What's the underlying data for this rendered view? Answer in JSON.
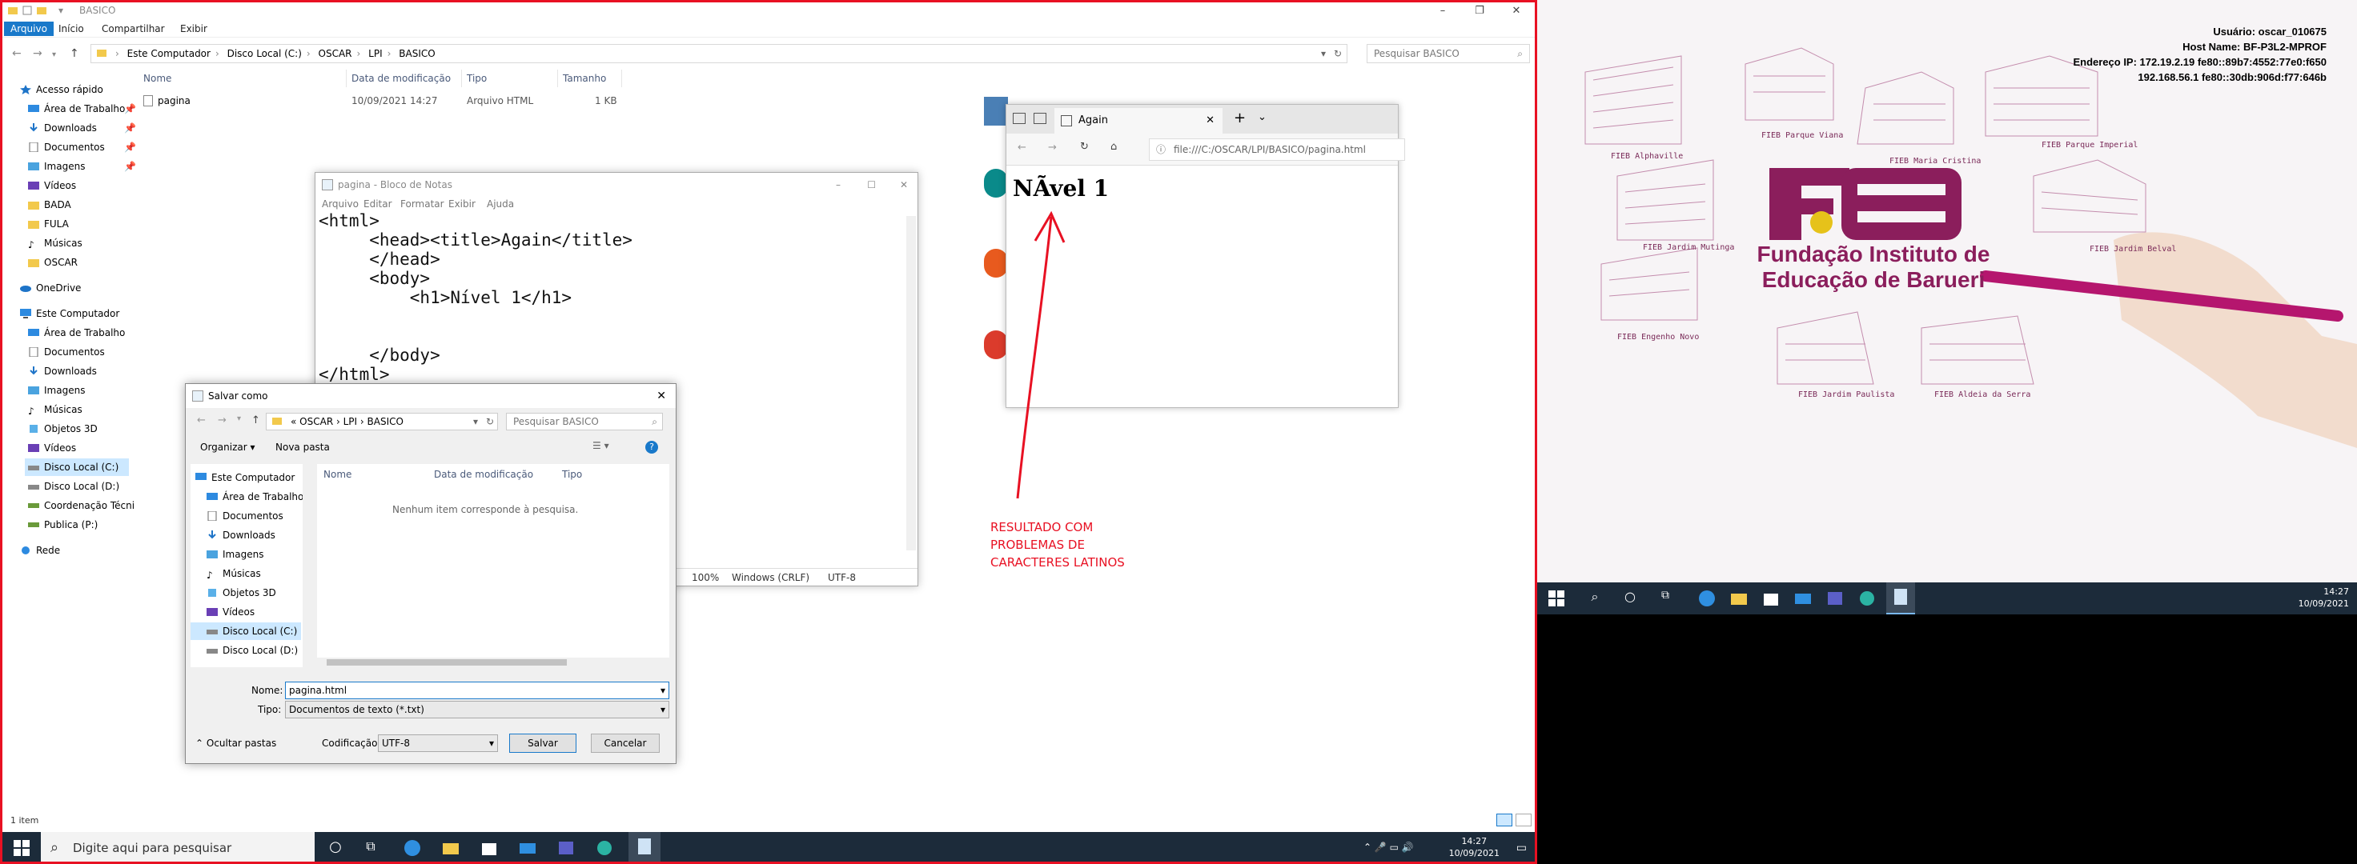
{
  "explorer": {
    "window_title": "BASICO",
    "ribbon_tabs": [
      "Arquivo",
      "Início",
      "Compartilhar",
      "Exibir"
    ],
    "breadcrumb": [
      "Este Computador",
      "Disco Local (C:)",
      "OSCAR",
      "LPI",
      "BASICO"
    ],
    "search_placeholder": "Pesquisar BASICO",
    "nav": [
      {
        "label": "Acesso rápido",
        "icon": "star-icon"
      },
      {
        "label": "Área de Trabalho",
        "icon": "desktop-icon"
      },
      {
        "label": "Downloads",
        "icon": "download-icon"
      },
      {
        "label": "Documentos",
        "icon": "document-icon"
      },
      {
        "label": "Imagens",
        "icon": "image-icon"
      },
      {
        "label": "Vídeos",
        "icon": "video-icon"
      },
      {
        "label": "BADA",
        "icon": "folder-icon"
      },
      {
        "label": "FULA",
        "icon": "folder-icon"
      },
      {
        "label": "Músicas",
        "icon": "music-icon"
      },
      {
        "label": "OSCAR",
        "icon": "folder-icon"
      },
      {
        "label": "OneDrive",
        "icon": "cloud-icon"
      },
      {
        "label": "Este Computador",
        "icon": "computer-icon"
      },
      {
        "label": "Área de Trabalho",
        "icon": "desktop-icon"
      },
      {
        "label": "Documentos",
        "icon": "document-icon"
      },
      {
        "label": "Downloads",
        "icon": "download-icon"
      },
      {
        "label": "Imagens",
        "icon": "image-icon"
      },
      {
        "label": "Músicas",
        "icon": "music-icon"
      },
      {
        "label": "Objetos 3D",
        "icon": "cube-icon"
      },
      {
        "label": "Vídeos",
        "icon": "video-icon"
      },
      {
        "label": "Disco Local (C:)",
        "icon": "drive-icon"
      },
      {
        "label": "Disco Local (D:)",
        "icon": "drive-icon"
      },
      {
        "label": "Coordenação Técni",
        "icon": "network-drive-icon"
      },
      {
        "label": "Publica (P:)",
        "icon": "network-drive-icon"
      },
      {
        "label": "Rede",
        "icon": "network-icon"
      }
    ],
    "columns": [
      "Nome",
      "Data de modificação",
      "Tipo",
      "Tamanho"
    ],
    "files": [
      {
        "name": "pagina",
        "modified": "10/09/2021 14:27",
        "type": "Arquivo HTML",
        "size": "1 KB"
      }
    ],
    "status": "1 item"
  },
  "notepad": {
    "title": "pagina - Bloco de Notas",
    "menu": [
      "Arquivo",
      "Editar",
      "Formatar",
      "Exibir",
      "Ajuda"
    ],
    "content": "<html>\n     <head><title>Again</title>\n     </head>\n     <body>\n         <h1>Nível 1</h1>\n\n\n     </body>\n</html>",
    "status": {
      "zoom": "100%",
      "eol": "Windows (CRLF)",
      "encoding": "UTF-8"
    }
  },
  "save_dialog": {
    "title": "Salvar como",
    "breadcrumb": [
      "«",
      "OSCAR",
      "LPI",
      "BASICO"
    ],
    "search_placeholder": "Pesquisar BASICO",
    "organize": "Organizar ▾",
    "new_folder": "Nova pasta",
    "tree": [
      {
        "label": "Este Computador",
        "icon": "computer-icon"
      },
      {
        "label": "Área de Trabalho",
        "icon": "desktop-icon"
      },
      {
        "label": "Documentos",
        "icon": "document-icon"
      },
      {
        "label": "Downloads",
        "icon": "download-icon"
      },
      {
        "label": "Imagens",
        "icon": "image-icon"
      },
      {
        "label": "Músicas",
        "icon": "music-icon"
      },
      {
        "label": "Objetos 3D",
        "icon": "cube-icon"
      },
      {
        "label": "Vídeos",
        "icon": "video-icon"
      },
      {
        "label": "Disco Local (C:)",
        "icon": "drive-icon"
      },
      {
        "label": "Disco Local (D:)",
        "icon": "drive-icon"
      }
    ],
    "columns": [
      "Nome",
      "Data de modificação",
      "Tipo"
    ],
    "empty_msg": "Nenhum item corresponde à pesquisa.",
    "name_label": "Nome:",
    "name_value": "pagina.html",
    "type_label": "Tipo:",
    "type_value": "Documentos de texto (*.txt)",
    "encoding_label": "Codificação:",
    "encoding_value": "UTF-8",
    "hide_folders": "Ocultar pastas",
    "save": "Salvar",
    "cancel": "Cancelar"
  },
  "browser": {
    "tab_title": "Again",
    "url": "file:///C:/OSCAR/LPI/BASICO/pagina.html",
    "heading": "NÃvel 1"
  },
  "annotation": {
    "lines": [
      "RESULTADO COM",
      "PROBLEMAS DE",
      "CARACTERES LATINOS"
    ],
    "color": "#e81123"
  },
  "taskbar_left": {
    "search_placeholder": "Digite aqui para pesquisar",
    "time": "14:27",
    "date": "10/09/2021"
  },
  "right_screen": {
    "bginfo": [
      "Usuário: oscar_010675",
      "Host Name: BF-P3L2-MPROF",
      "Endereço IP: 172.19.2.19 fe80::89b7:4552:77e0:f650",
      "192.168.56.1 fe80::30db:906d:f77:646b"
    ],
    "building_labels": [
      "FIEB Alphaville",
      "FIEB Parque Viana",
      "FIEB Maria Cristina",
      "FIEB Parque Imperial",
      "FIEB Jardim Mutinga",
      "FIEB Jardim Belval",
      "FIEB Engenho Novo",
      "FIEB Jardim Paulista",
      "FIEB Aldeia da Serra"
    ],
    "brand_name_lines": [
      "Fundação Instituto de",
      "Educação de Barueri"
    ],
    "brand_color": "#8b1e5c",
    "time": "14:27",
    "date": "10/09/2021"
  }
}
